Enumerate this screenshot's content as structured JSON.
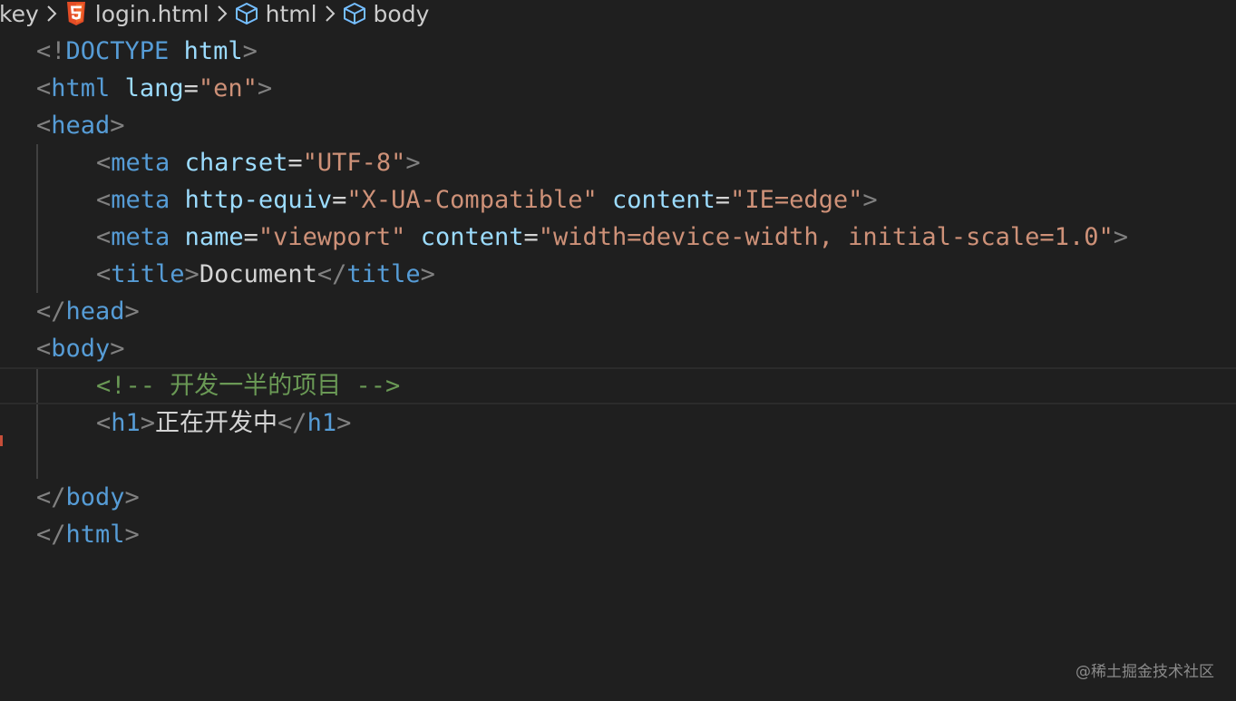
{
  "breadcrumb": {
    "items": [
      {
        "label": "-key",
        "icon": null
      },
      {
        "label": "login.html",
        "icon": "html5-icon"
      },
      {
        "label": "html",
        "icon": "cube-icon"
      },
      {
        "label": "body",
        "icon": "cube-icon"
      }
    ],
    "separator_icon": "chevron-right-icon",
    "html5_color": "#e44d26",
    "cube_color": "#75beff"
  },
  "editor": {
    "colors": {
      "background": "#1f1f1f",
      "tag": "#569cd6",
      "punctuation": "#808080",
      "attribute": "#9cdcfe",
      "string": "#ce9178",
      "text": "#d4d4d4",
      "comment": "#6a9955"
    },
    "lines": [
      {
        "tokens": [
          [
            "punc",
            "<!"
          ],
          [
            "tag",
            "DOCTYPE"
          ],
          [
            "text",
            " "
          ],
          [
            "attr",
            "html"
          ],
          [
            "punc",
            ">"
          ]
        ]
      },
      {
        "tokens": [
          [
            "punc",
            "<"
          ],
          [
            "tag",
            "html"
          ],
          [
            "text",
            " "
          ],
          [
            "attr",
            "lang"
          ],
          [
            "op",
            "="
          ],
          [
            "str",
            "\"en\""
          ],
          [
            "punc",
            ">"
          ]
        ]
      },
      {
        "tokens": [
          [
            "punc",
            "<"
          ],
          [
            "tag",
            "head"
          ],
          [
            "punc",
            ">"
          ]
        ]
      },
      {
        "tokens": [
          [
            "punc",
            "<"
          ],
          [
            "tag",
            "meta"
          ],
          [
            "text",
            " "
          ],
          [
            "attr",
            "charset"
          ],
          [
            "op",
            "="
          ],
          [
            "str",
            "\"UTF-8\""
          ],
          [
            "punc",
            ">"
          ]
        ]
      },
      {
        "tokens": [
          [
            "punc",
            "<"
          ],
          [
            "tag",
            "meta"
          ],
          [
            "text",
            " "
          ],
          [
            "attr",
            "http-equiv"
          ],
          [
            "op",
            "="
          ],
          [
            "str",
            "\"X-UA-Compatible\""
          ],
          [
            "text",
            " "
          ],
          [
            "attr",
            "content"
          ],
          [
            "op",
            "="
          ],
          [
            "str",
            "\"IE=edge\""
          ],
          [
            "punc",
            ">"
          ]
        ]
      },
      {
        "tokens": [
          [
            "punc",
            "<"
          ],
          [
            "tag",
            "meta"
          ],
          [
            "text",
            " "
          ],
          [
            "attr",
            "name"
          ],
          [
            "op",
            "="
          ],
          [
            "str",
            "\"viewport\""
          ],
          [
            "text",
            " "
          ],
          [
            "attr",
            "content"
          ],
          [
            "op",
            "="
          ],
          [
            "str",
            "\"width=device-width, initial-scale=1.0\""
          ],
          [
            "punc",
            ">"
          ]
        ]
      },
      {
        "tokens": [
          [
            "punc",
            "<"
          ],
          [
            "tag",
            "title"
          ],
          [
            "punc",
            ">"
          ],
          [
            "text",
            "Document"
          ],
          [
            "punc",
            "</"
          ],
          [
            "tag",
            "title"
          ],
          [
            "punc",
            ">"
          ]
        ]
      },
      {
        "tokens": [
          [
            "punc",
            "</"
          ],
          [
            "tag",
            "head"
          ],
          [
            "punc",
            ">"
          ]
        ]
      },
      {
        "tokens": [
          [
            "punc",
            "<"
          ],
          [
            "tag",
            "body"
          ],
          [
            "punc",
            ">"
          ]
        ]
      },
      {
        "tokens": [
          [
            "comment",
            "<!-- 开发一半的项目 -->"
          ]
        ]
      },
      {
        "tokens": [
          [
            "punc",
            "<"
          ],
          [
            "tag",
            "h1"
          ],
          [
            "punc",
            ">"
          ],
          [
            "text",
            "正在开发中"
          ],
          [
            "punc",
            "</"
          ],
          [
            "tag",
            "h1"
          ],
          [
            "punc",
            ">"
          ]
        ]
      },
      {
        "tokens": []
      },
      {
        "tokens": [
          [
            "punc",
            "</"
          ],
          [
            "tag",
            "body"
          ],
          [
            "punc",
            ">"
          ]
        ]
      },
      {
        "tokens": [
          [
            "punc",
            "</"
          ],
          [
            "tag",
            "html"
          ],
          [
            "punc",
            ">"
          ]
        ]
      }
    ]
  },
  "watermark": "@稀土掘金技术社区"
}
